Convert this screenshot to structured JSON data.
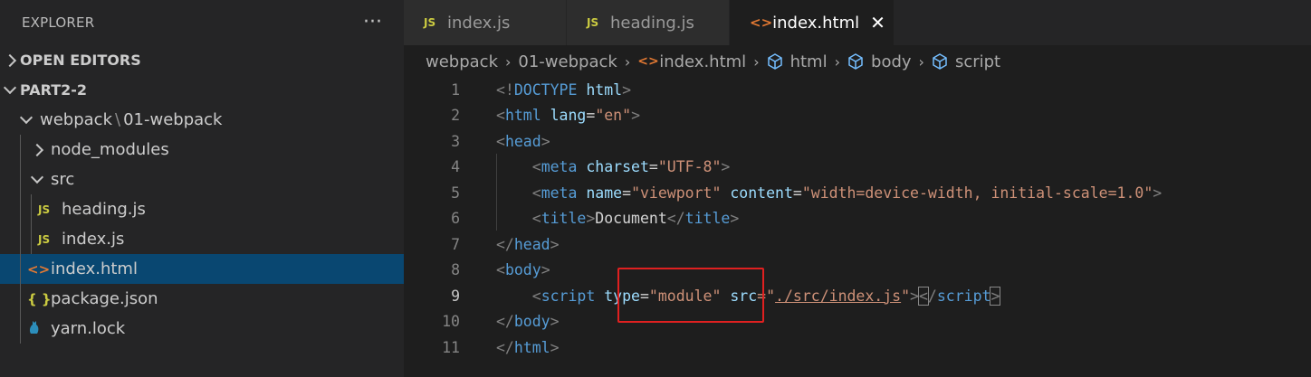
{
  "sidebar": {
    "title": "EXPLORER",
    "more": "···",
    "sections": {
      "open_editors": "OPEN EDITORS",
      "workspace": "PART2-2"
    },
    "folder_path": {
      "part1": "webpack",
      "sep": "\\",
      "part2": "01-webpack"
    },
    "items": {
      "node_modules": "node_modules",
      "src": "src",
      "heading_js": "heading.js",
      "index_js": "index.js",
      "index_html": "index.html",
      "package_json": "package.json",
      "yarn_lock": "yarn.lock"
    },
    "icons": {
      "js": "JS",
      "html": "<>",
      "json": "{ }"
    }
  },
  "tabs": [
    {
      "label": "index.js",
      "icon": "JS"
    },
    {
      "label": "heading.js",
      "icon": "JS"
    },
    {
      "label": "index.html",
      "icon": "<>",
      "close": "✕"
    }
  ],
  "breadcrumb": [
    "webpack",
    "01-webpack",
    "index.html",
    "html",
    "body",
    "script"
  ],
  "code": {
    "line_numbers": [
      "1",
      "2",
      "3",
      "4",
      "5",
      "6",
      "7",
      "8",
      "9",
      "10",
      "11"
    ],
    "l1": {
      "open": "<!",
      "doctype": "DOCTYPE",
      "sp": " ",
      "html": "html",
      "close": ">"
    },
    "l2": {
      "open": "<",
      "tag": "html",
      "sp": " ",
      "attr": "lang",
      "eq": "=",
      "val": "\"en\"",
      "close": ">"
    },
    "l3": {
      "open": "<",
      "tag": "head",
      "close": ">"
    },
    "l4": {
      "indent": "    ",
      "open": "<",
      "tag": "meta",
      "sp": " ",
      "attr": "charset",
      "eq": "=",
      "val": "\"UTF-8\"",
      "close": ">"
    },
    "l5": {
      "indent": "    ",
      "open": "<",
      "tag": "meta",
      "sp1": " ",
      "attr1": "name",
      "eq1": "=",
      "val1": "\"viewport\"",
      "sp2": " ",
      "attr2": "content",
      "eq2": "=",
      "val2": "\"width=device-width, initial-scale=1.0\"",
      "close": ">"
    },
    "l6": {
      "indent": "    ",
      "open": "<",
      "tag": "title",
      "close": ">",
      "text": "Document",
      "open2": "</",
      "tag2": "title",
      "close2": ">"
    },
    "l7": {
      "open": "</",
      "tag": "head",
      "close": ">"
    },
    "l8": {
      "open": "<",
      "tag": "body",
      "close": ">"
    },
    "l9": {
      "indent": "    ",
      "open": "<",
      "tag": "script",
      "sp1": " ",
      "attr1": "type",
      "eq1": "=",
      "val1": "\"module\"",
      "sp2": " ",
      "attr2": "src",
      "eq2": "=\"",
      "val2": "./src/index.js",
      "q": "\"",
      "close": ">",
      "open2": "<",
      "slash": "/",
      "tag2": "script",
      "close2": ">"
    },
    "l10": {
      "open": "</",
      "tag": "body",
      "close": ">"
    },
    "l11": {
      "open": "</",
      "tag": "html",
      "close": ">"
    }
  },
  "colors": {
    "tag": "#569cd6",
    "attribute": "#9cdcfe",
    "string": "#ce9178",
    "highlight_box": "#e02020",
    "selection": "#094771"
  }
}
